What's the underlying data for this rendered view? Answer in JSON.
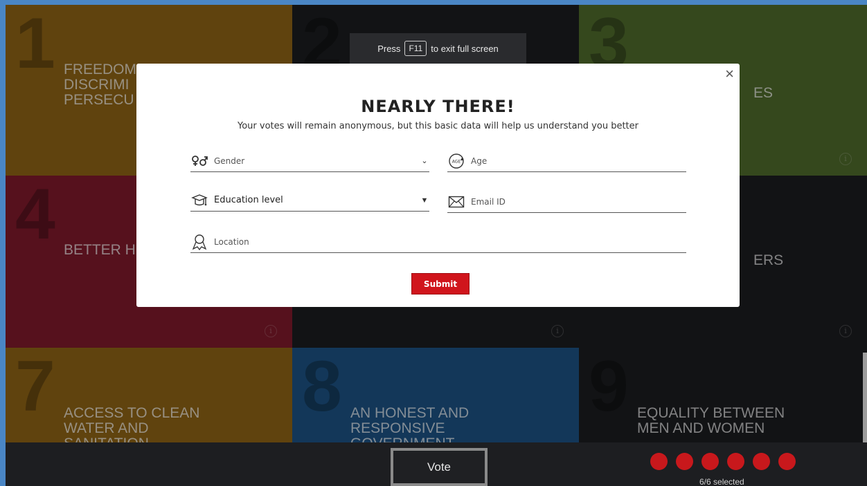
{
  "fullscreen_banner": {
    "press": "Press",
    "key": "F11",
    "rest": "to exit full screen"
  },
  "tiles": [
    {
      "number": "1",
      "title": "FREEDOM\nDISCRIMI\nPERSECU",
      "color": "#8e6316"
    },
    {
      "number": "2",
      "title": "",
      "color": "#1b1c1f"
    },
    {
      "number": "3",
      "title": "ES",
      "color": "#4f6a2c"
    },
    {
      "number": "4",
      "title": "BETTER H",
      "color": "#7f1a2b"
    },
    {
      "number": "",
      "title": "",
      "color": "#1b1c1f"
    },
    {
      "number": "",
      "title": "ERS",
      "color": "#1b1c1f"
    },
    {
      "number": "7",
      "title": "ACCESS TO CLEAN\nWATER AND\nSANITATION",
      "color": "#8e6316"
    },
    {
      "number": "8",
      "title": "AN HONEST AND\nRESPONSIVE\nGOVERNMENT",
      "color": "#1d5283"
    },
    {
      "number": "9",
      "title": "EQUALITY BETWEEN\nMEN AND WOMEN",
      "color": "#1b1c1f"
    }
  ],
  "info_symbol": "i",
  "modal": {
    "close": "×",
    "title": "NEARLY THERE!",
    "subtitle": "Your votes will remain anonymous, but this basic data will help us understand you better",
    "gender": {
      "label": "Gender",
      "icon": "gender-icon"
    },
    "age": {
      "label": "Age",
      "icon": "age-icon"
    },
    "education": {
      "label": "Education level",
      "icon": "graduation-cap-icon"
    },
    "email": {
      "label": "Email ID",
      "icon": "envelope-icon"
    },
    "location": {
      "label": "Location",
      "icon": "location-pin-icon"
    },
    "submit": "Submit"
  },
  "bottom": {
    "vote": "Vote",
    "selected_text": "6/6 selected",
    "selected_count": 6,
    "dot_color": "#c8181c"
  }
}
